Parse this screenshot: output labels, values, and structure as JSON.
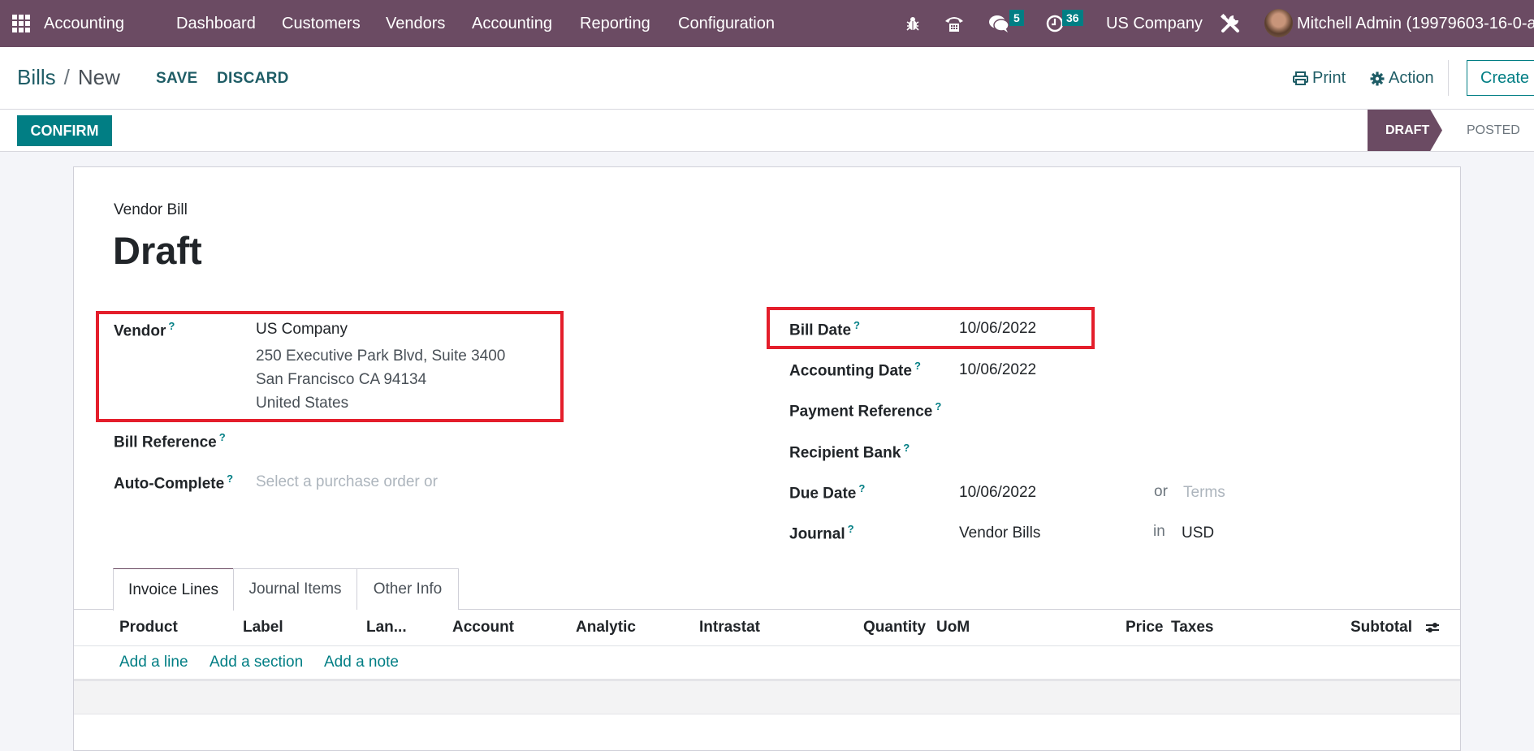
{
  "navbar": {
    "app_name": "Accounting",
    "menu": [
      "Dashboard",
      "Customers",
      "Vendors",
      "Accounting",
      "Reporting",
      "Configuration"
    ],
    "messages_count": "5",
    "activities_count": "36",
    "company": "US Company",
    "user": "Mitchell Admin (19979603-16-0-a"
  },
  "control_panel": {
    "breadcrumb_parent": "Bills",
    "breadcrumb_separator": "/",
    "breadcrumb_current": "New",
    "save_label": "SAVE",
    "discard_label": "DISCARD",
    "print_label": "Print",
    "action_label": "Action",
    "create_label": "Create"
  },
  "statusbar": {
    "confirm_label": "CONFIRM",
    "stages": [
      "DRAFT",
      "POSTED"
    ],
    "active_stage": "DRAFT"
  },
  "form": {
    "doc_type": "Vendor Bill",
    "title": "Draft",
    "help_mark": "?",
    "left": {
      "vendor_label": "Vendor",
      "vendor_name": "US Company",
      "vendor_address": [
        "250 Executive Park Blvd, Suite 3400",
        "San Francisco CA 94134",
        "United States"
      ],
      "bill_reference_label": "Bill Reference",
      "bill_reference_value": "",
      "auto_complete_label": "Auto-Complete",
      "auto_complete_placeholder": "Select a purchase order or"
    },
    "right": {
      "bill_date_label": "Bill Date",
      "bill_date": "10/06/2022",
      "accounting_date_label": "Accounting Date",
      "accounting_date": "10/06/2022",
      "payment_reference_label": "Payment Reference",
      "payment_reference": "",
      "recipient_bank_label": "Recipient Bank",
      "recipient_bank": "",
      "due_date_label": "Due Date",
      "due_date": "10/06/2022",
      "or_label": "or",
      "terms_placeholder": "Terms",
      "journal_label": "Journal",
      "journal": "Vendor Bills",
      "in_label": "in",
      "currency": "USD"
    }
  },
  "tabs": [
    "Invoice Lines",
    "Journal Items",
    "Other Info"
  ],
  "active_tab": "Invoice Lines",
  "invoice_lines": {
    "columns": [
      "Product",
      "Label",
      "Lan...",
      "Account",
      "Analytic",
      "Intrastat",
      "Quantity",
      "UoM",
      "Price",
      "Taxes",
      "Subtotal"
    ],
    "rows": [],
    "add_line": "Add a line",
    "add_section": "Add a section",
    "add_note": "Add a note"
  }
}
